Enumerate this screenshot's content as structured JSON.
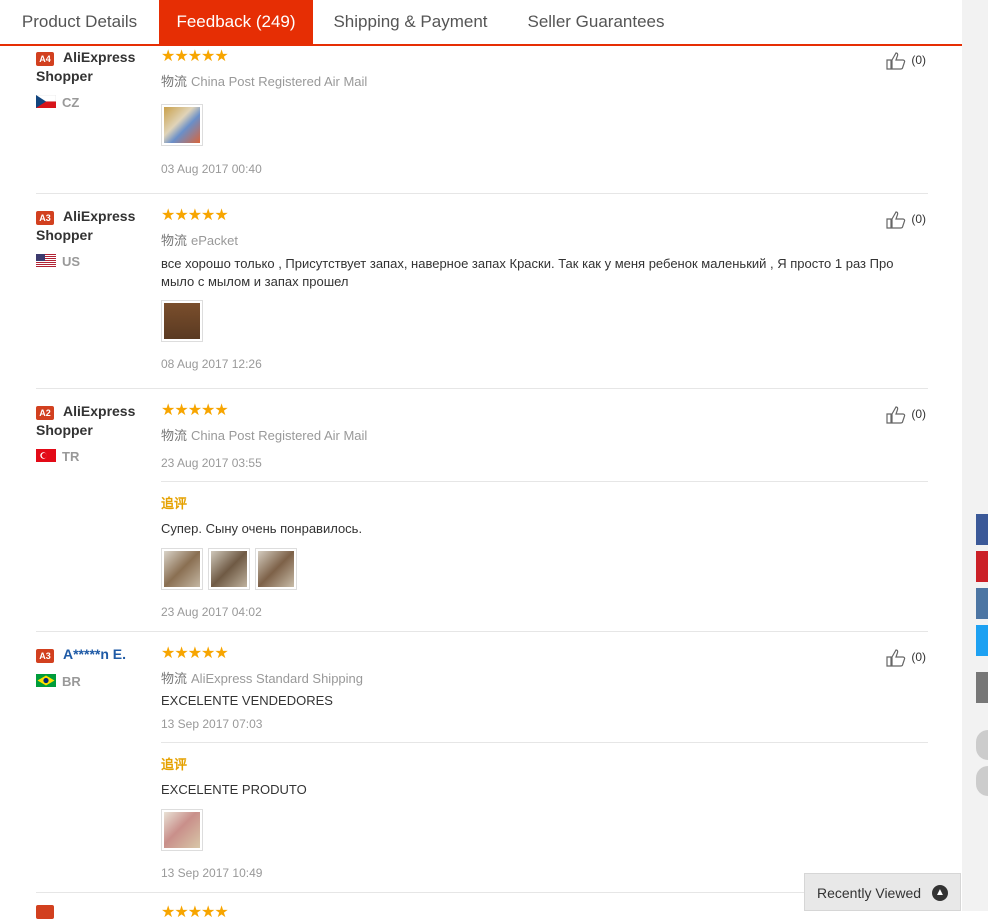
{
  "tabs": [
    {
      "label": "Product Details"
    },
    {
      "label": "Feedback (249)"
    },
    {
      "label": "Shipping & Payment"
    },
    {
      "label": "Seller Guarantees"
    }
  ],
  "logistics_label": "物流",
  "additional_label": "追评",
  "stars": "★★★★★",
  "reviews": [
    {
      "badge": "A4",
      "name": "AliExpress Shopper",
      "country": "CZ",
      "rating": 5,
      "logistics": "China Post Registered Air Mail",
      "text": "",
      "date": "03 Aug 2017 00:40",
      "likes": "(0)",
      "photos": 1
    },
    {
      "badge": "A3",
      "name": "AliExpress Shopper",
      "country": "US",
      "rating": 5,
      "logistics": "ePacket",
      "text": "все хорошо только , Присутствует запах, наверное запах Краски. Так как у меня ребенок маленький , Я просто 1 раз Про мыло с мылом и запах прошел",
      "date": "08 Aug 2017 12:26",
      "likes": "(0)",
      "photos": 1
    },
    {
      "badge": "A2",
      "name": "AliExpress Shopper",
      "country": "TR",
      "rating": 5,
      "logistics": "China Post Registered Air Mail",
      "text": "",
      "date": "23 Aug 2017 03:55",
      "likes": "(0)",
      "additional": {
        "text": "Супер. Сыну очень понравилось.",
        "date": "23 Aug 2017 04:02",
        "photos": 3
      }
    },
    {
      "badge": "A3",
      "name": "A*****n E.",
      "country": "BR",
      "rating": 5,
      "logistics": "AliExpress Standard Shipping",
      "text": "EXCELENTE VENDEDORES",
      "date": "13 Sep 2017 07:03",
      "likes": "(0)",
      "additional": {
        "text": "EXCELENTE PRODUTO",
        "date": "13 Sep 2017 10:49",
        "photos": 1
      }
    }
  ],
  "recently_viewed": "Recently Viewed",
  "colors": {
    "accent": "#e62e04",
    "star": "#f7a500",
    "additional": "#e5a100"
  }
}
